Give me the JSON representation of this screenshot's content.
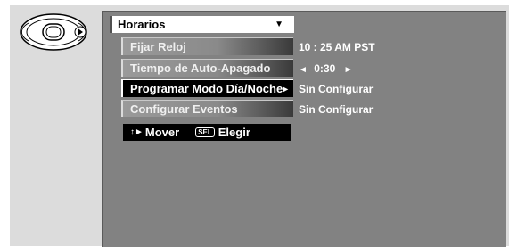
{
  "menu": {
    "title": "Horarios",
    "title_arrow": "▼",
    "items": [
      {
        "label": "Fijar Reloj",
        "value": "10 : 25 AM PST"
      },
      {
        "label": "Tiempo de Auto-Apagado",
        "value": "0:30"
      },
      {
        "label": "Programar Modo Día/Noche",
        "value": "Sin Configurar",
        "selected": true,
        "submenu_arrow": "►"
      },
      {
        "label": "Configurar Eventos",
        "value": "Sin Configurar"
      }
    ],
    "value_left_arrow": "◄",
    "value_right_arrow": "►"
  },
  "help": {
    "move_icon": "↕►",
    "move_label": "Mover",
    "sel_key": "SEL",
    "select_label": "Elegir"
  },
  "remote_pad": {
    "icon": "dpad-right-icon"
  },
  "colors": {
    "screen_bg": "#828282",
    "selected_bg": "#000000",
    "text": "#ffffff"
  }
}
